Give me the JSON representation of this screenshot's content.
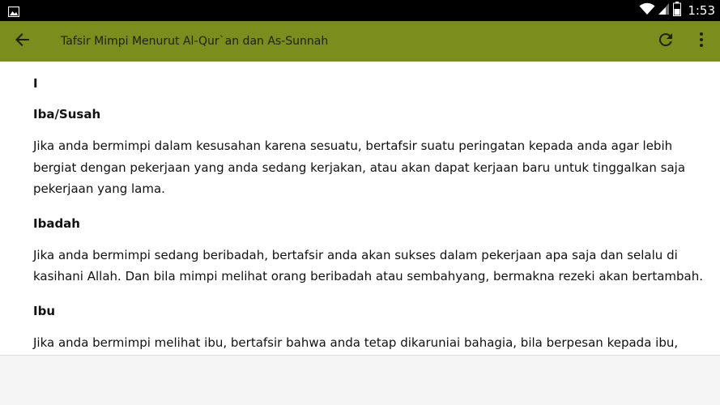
{
  "status_bar": {
    "time": "1:53",
    "left_icon": "image-icon",
    "icons": [
      "wifi-icon",
      "signal-icon",
      "battery-icon"
    ]
  },
  "app_bar": {
    "title": "Tafsir Mimpi Menurut Al-Qur`an dan As-Sunnah",
    "background_color": "#7b8d1c",
    "back_icon": "arrow-back-icon",
    "refresh_icon": "refresh-icon",
    "menu_icon": "more-vert-icon"
  },
  "content": {
    "letter": "I",
    "entries": [
      {
        "title": "Iba/Susah",
        "text": "Jika anda bermimpi dalam kesusahan karena sesuatu, bertafsir suatu peringatan kepada anda agar lebih bergiat dengan pekerjaan yang anda sedang kerjakan, atau akan dapat kerjaan baru untuk tinggalkan saja pekerjaan yang lama."
      },
      {
        "title": "Ibadah",
        "text": "Jika anda bermimpi sedang beribadah, bertafsir anda akan sukses dalam pekerjaan apa saja dan selalu di kasihani Allah. Dan bila mimpi melihat orang beribadah atau sembahyang, bermakna rezeki akan bertambah."
      },
      {
        "title": "Ibu",
        "text": "Jika anda bermimpi melihat ibu, bertafsir bahwa anda tetap dikaruniai bahagia, bila berpesan kepada ibu,"
      }
    ]
  }
}
